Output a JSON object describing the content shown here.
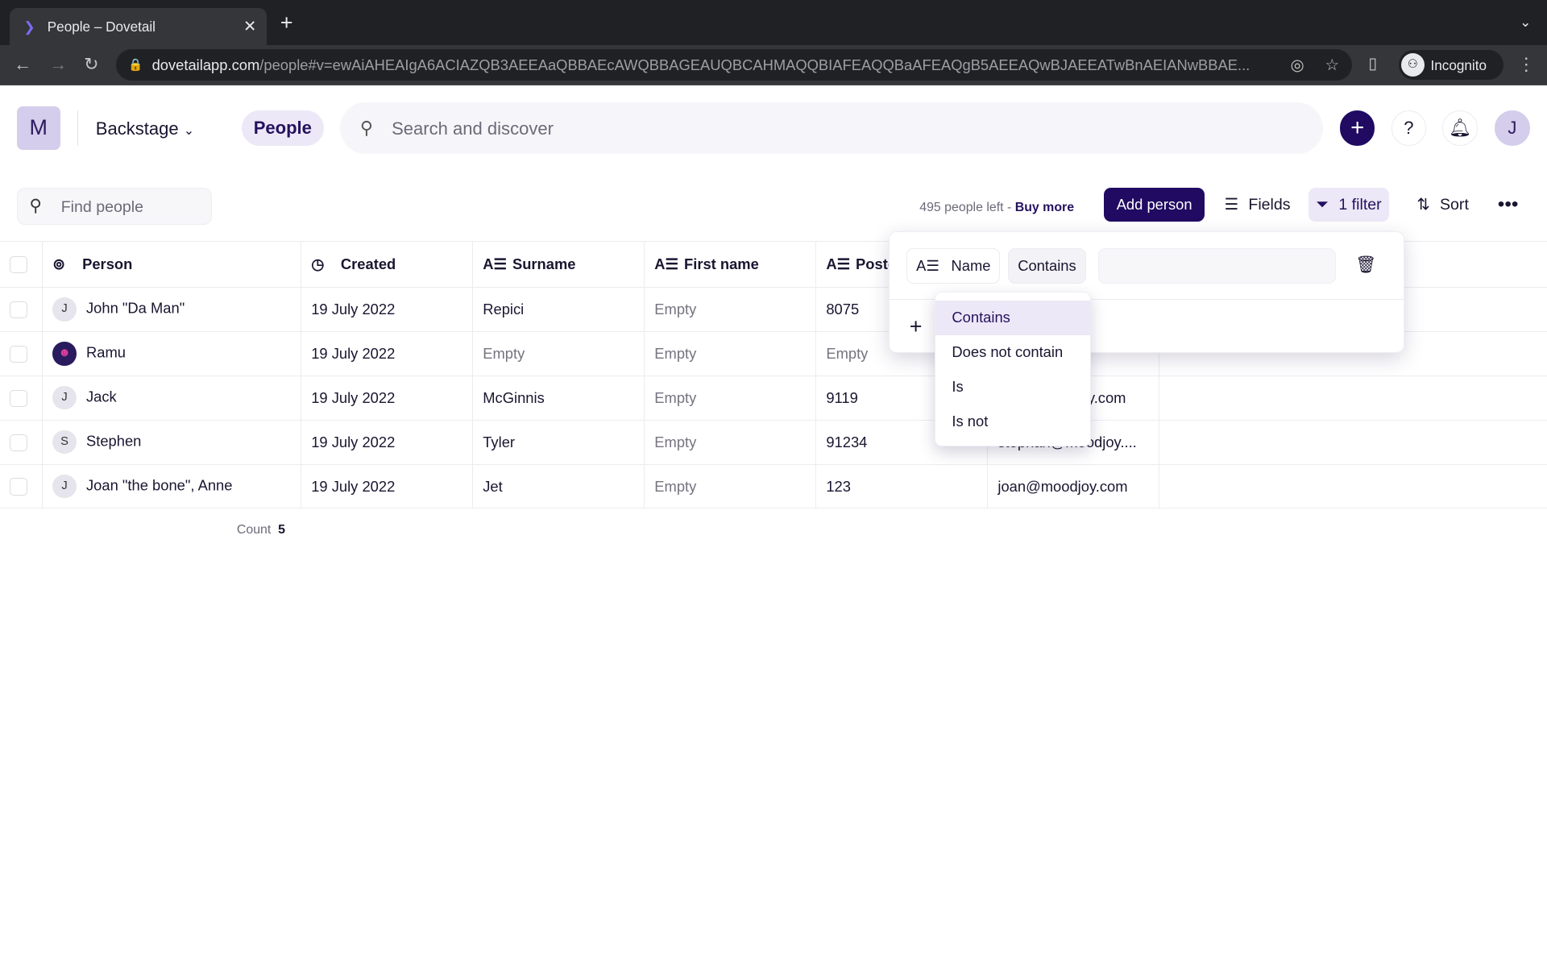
{
  "browser": {
    "tab_title": "People – Dovetail",
    "url_domain": "dovetailapp.com",
    "url_path": "/people#v=ewAiAHEAIgA6ACIAZQB3AEEAaQBBAEcAWQBBAGEAUQBCAHMAQQBIAFEAQQBaAFEAQgB5AEEAQwBJAEEATwBnAEIANwBBAE...",
    "profile": "Incognito"
  },
  "header": {
    "workspace_initial": "M",
    "workspace": "Backstage",
    "nav_active": "People",
    "search_placeholder": "Search and discover",
    "avatar_initial": "J"
  },
  "toolbar": {
    "find_placeholder": "Find people",
    "people_left": "495 people left - ",
    "buy_more": "Buy more",
    "add_person": "Add person",
    "fields": "Fields",
    "filter": "1 filter",
    "sort": "Sort"
  },
  "table": {
    "columns": [
      "Person",
      "Created",
      "Surname",
      "First name",
      "Postcode",
      ""
    ],
    "rows": [
      {
        "initial": "J",
        "person": "John \"Da Man\"",
        "created": "19 July 2022",
        "surname": "Repici",
        "first": "Empty",
        "post": "8075",
        "email": ""
      },
      {
        "initial": "",
        "person": "Ramu",
        "created": "19 July 2022",
        "surname": "Empty",
        "first": "Empty",
        "post": "Empty",
        "email": ""
      },
      {
        "initial": "J",
        "person": "Jack",
        "created": "19 July 2022",
        "surname": "McGinnis",
        "first": "Empty",
        "post": "9119",
        "email": "jack@moodjoy.com"
      },
      {
        "initial": "S",
        "person": "Stephen",
        "created": "19 July 2022",
        "surname": "Tyler",
        "first": "Empty",
        "post": "91234",
        "email": "stephan@moodjoy...."
      },
      {
        "initial": "J",
        "person": "Joan \"the bone\", Anne",
        "created": "19 July 2022",
        "surname": "Jet",
        "first": "Empty",
        "post": "123",
        "email": "joan@moodjoy.com"
      }
    ],
    "count_label": "Count",
    "count": "5"
  },
  "filter": {
    "field": "Name",
    "operator": "Contains",
    "value": "",
    "options": [
      "Contains",
      "Does not contain",
      "Is",
      "Is not"
    ]
  },
  "colors": {
    "accent": "#200a62",
    "selected": "#ece8f7"
  }
}
